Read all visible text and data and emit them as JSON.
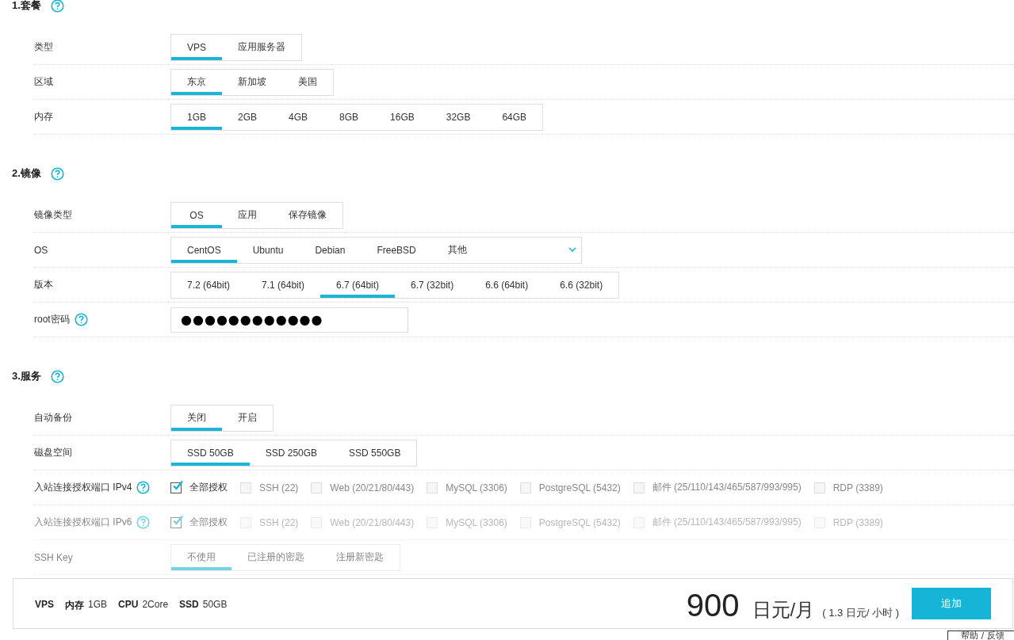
{
  "sections": [
    {
      "title": "1.套餐",
      "help": true,
      "rows": [
        {
          "kind": "segment",
          "label": "类型",
          "disabled": false,
          "options": [
            {
              "label": "VPS",
              "selected": true
            },
            {
              "label": "应用服务器",
              "selected": false
            }
          ]
        },
        {
          "kind": "segment",
          "label": "区域",
          "disabled": false,
          "options": [
            {
              "label": "东京",
              "selected": true
            },
            {
              "label": "新加坡",
              "selected": false
            },
            {
              "label": "美国",
              "selected": false
            }
          ]
        },
        {
          "kind": "segment",
          "label": "内存",
          "disabled": false,
          "options": [
            {
              "label": "1GB",
              "selected": true
            },
            {
              "label": "2GB",
              "selected": false
            },
            {
              "label": "4GB",
              "selected": false
            },
            {
              "label": "8GB",
              "selected": false
            },
            {
              "label": "16GB",
              "selected": false
            },
            {
              "label": "32GB",
              "selected": false
            },
            {
              "label": "64GB",
              "selected": false
            }
          ]
        }
      ]
    },
    {
      "title": "2.镜像",
      "help": true,
      "rows": [
        {
          "kind": "segment",
          "label": "镜像类型",
          "disabled": false,
          "options": [
            {
              "label": "OS",
              "selected": true
            },
            {
              "label": "应用",
              "selected": false
            },
            {
              "label": "保存镜像",
              "selected": false
            }
          ]
        },
        {
          "kind": "dropdown",
          "label": "OS",
          "disabled": false,
          "options": [
            {
              "label": "CentOS",
              "selected": true
            },
            {
              "label": "Ubuntu",
              "selected": false
            },
            {
              "label": "Debian",
              "selected": false
            },
            {
              "label": "FreeBSD",
              "selected": false
            },
            {
              "label": "其他",
              "selected": false
            }
          ]
        },
        {
          "kind": "segment",
          "label": "版本",
          "disabled": false,
          "options": [
            {
              "label": "7.2 (64bit)",
              "selected": false
            },
            {
              "label": "7.1 (64bit)",
              "selected": false
            },
            {
              "label": "6.7 (64bit)",
              "selected": true
            },
            {
              "label": "6.7 (32bit)",
              "selected": false
            },
            {
              "label": "6.6 (64bit)",
              "selected": false
            },
            {
              "label": "6.6 (32bit)",
              "selected": false
            }
          ]
        },
        {
          "kind": "password",
          "label": "root密码",
          "help": true,
          "disabled": false,
          "value": "●●●●●●●●●●●●"
        }
      ]
    },
    {
      "title": "3.服务",
      "help": true,
      "rows": [
        {
          "kind": "segment",
          "label": "自动备份",
          "disabled": false,
          "options": [
            {
              "label": "关闭",
              "selected": true
            },
            {
              "label": "开启",
              "selected": false
            }
          ]
        },
        {
          "kind": "segment",
          "label": "磁盘空间",
          "disabled": false,
          "options": [
            {
              "label": "SSD 50GB",
              "selected": true
            },
            {
              "label": "SSD 250GB",
              "selected": false
            },
            {
              "label": "SSD 550GB",
              "selected": false
            }
          ]
        },
        {
          "kind": "checkboxes",
          "label": "入站连接授权端口 IPv4",
          "help": true,
          "disabled": false,
          "options": [
            {
              "label": "全部授权",
              "checked": true,
              "disabled": false
            },
            {
              "label": "SSH (22)",
              "checked": false,
              "disabled": true
            },
            {
              "label": "Web (20/21/80/443)",
              "checked": false,
              "disabled": true
            },
            {
              "label": "MySQL (3306)",
              "checked": false,
              "disabled": true
            },
            {
              "label": "PostgreSQL (5432)",
              "checked": false,
              "disabled": true
            },
            {
              "label": "邮件 (25/110/143/465/587/993/995)",
              "checked": false,
              "disabled": true
            },
            {
              "label": "RDP (3389)",
              "checked": false,
              "disabled": true
            }
          ]
        },
        {
          "kind": "checkboxes",
          "label": "入站连接授权端口 IPv6",
          "help": true,
          "disabled": true,
          "options": [
            {
              "label": "全部授权",
              "checked": true,
              "disabled": false
            },
            {
              "label": "SSH (22)",
              "checked": false,
              "disabled": true
            },
            {
              "label": "Web (20/21/80/443)",
              "checked": false,
              "disabled": true
            },
            {
              "label": "MySQL (3306)",
              "checked": false,
              "disabled": true
            },
            {
              "label": "PostgreSQL (5432)",
              "checked": false,
              "disabled": true
            },
            {
              "label": "邮件 (25/110/143/465/587/993/995)",
              "checked": false,
              "disabled": true
            },
            {
              "label": "RDP (3389)",
              "checked": false,
              "disabled": true
            }
          ]
        },
        {
          "kind": "segment",
          "label": "SSH Key",
          "disabled": true,
          "options": [
            {
              "label": "不使用",
              "selected": true
            },
            {
              "label": "已注册的密匙",
              "selected": false
            },
            {
              "label": "注册新密匙",
              "selected": false
            }
          ]
        }
      ]
    }
  ],
  "summary": {
    "items": [
      {
        "key": "VPS"
      },
      {
        "key": "内存",
        "value": "1GB"
      },
      {
        "key": "CPU",
        "value": "2Core"
      },
      {
        "key": "SSD",
        "value": "50GB"
      }
    ],
    "price": "900",
    "unit": "日元/月",
    "hourly": "( 1.3 日元/ 小时 )",
    "button": "追加"
  },
  "help_button": "帮助 / 反馈"
}
